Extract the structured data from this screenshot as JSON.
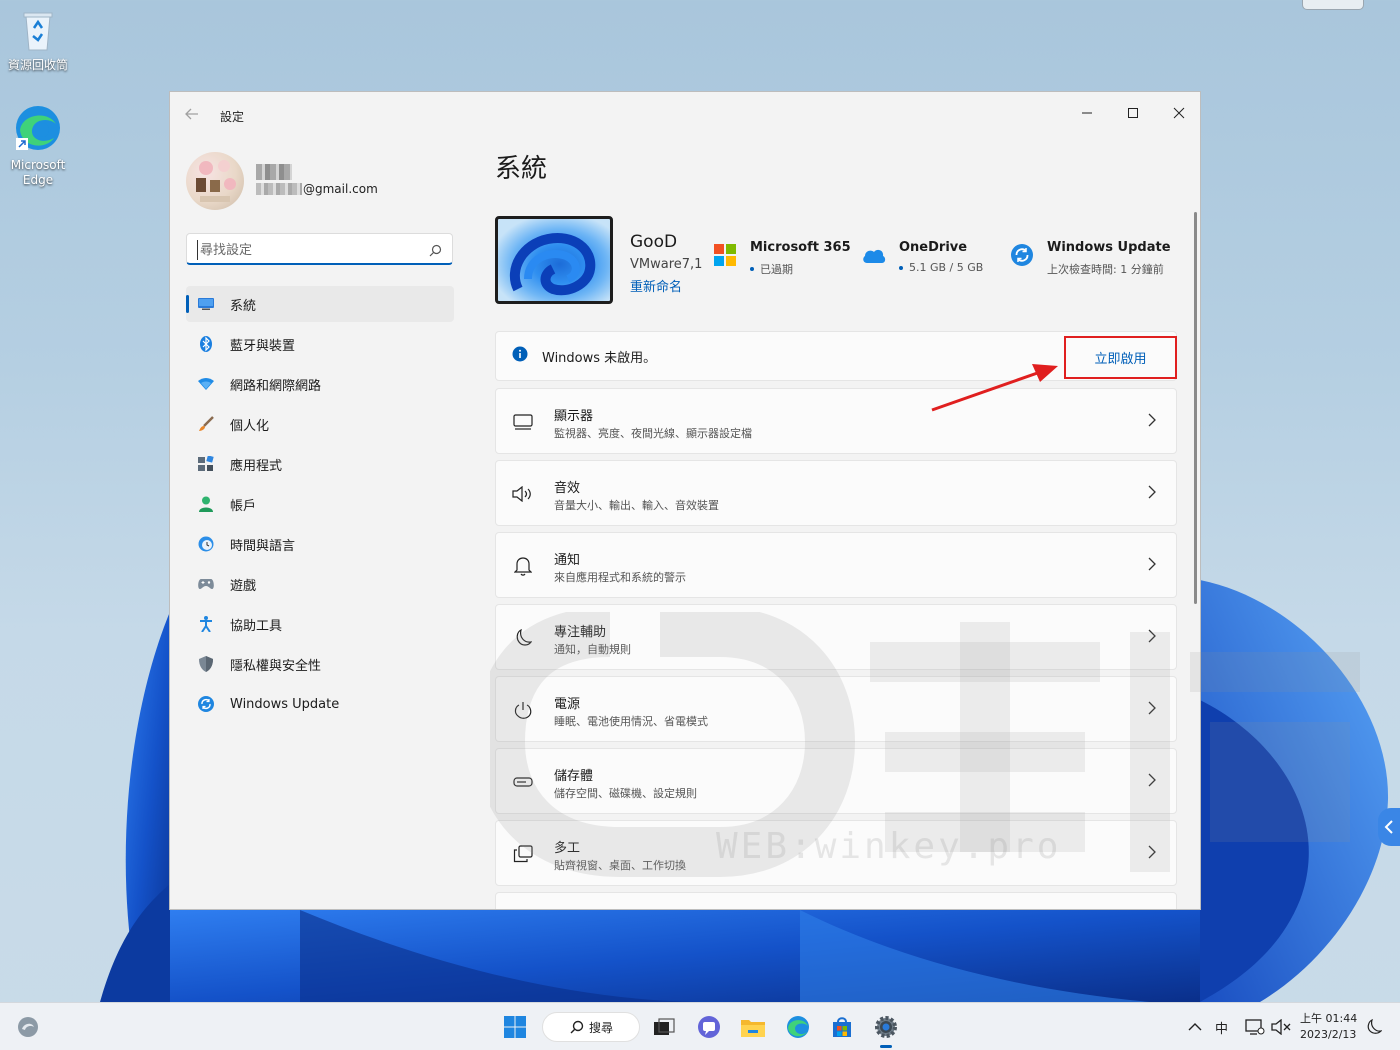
{
  "desktop": {
    "icons": [
      {
        "label": "資源回收筒"
      },
      {
        "label": "Microsoft Edge"
      }
    ]
  },
  "window": {
    "title": "設定",
    "controls": {
      "minimize": "—",
      "maximize": "☐",
      "close": "✕"
    }
  },
  "profile": {
    "email_suffix": "@gmail.com"
  },
  "search": {
    "placeholder": "尋找設定"
  },
  "sidebar": {
    "items": [
      {
        "label": "系統",
        "icon": "system-icon",
        "active": true
      },
      {
        "label": "藍牙與裝置",
        "icon": "bluetooth-icon"
      },
      {
        "label": "網路和網際網路",
        "icon": "wifi-icon"
      },
      {
        "label": "個人化",
        "icon": "brush-icon"
      },
      {
        "label": "應用程式",
        "icon": "apps-icon"
      },
      {
        "label": "帳戶",
        "icon": "account-icon"
      },
      {
        "label": "時間與語言",
        "icon": "globe-clock-icon"
      },
      {
        "label": "遊戲",
        "icon": "gamepad-icon"
      },
      {
        "label": "協助工具",
        "icon": "accessibility-icon"
      },
      {
        "label": "隱私權與安全性",
        "icon": "shield-icon"
      },
      {
        "label": "Windows Update",
        "icon": "update-icon"
      }
    ]
  },
  "main": {
    "page_title": "系統",
    "device": {
      "name": "GooD",
      "model": "VMware7,1",
      "rename_label": "重新命名"
    },
    "info_cards": [
      {
        "title": "Microsoft 365",
        "subtitle": "已過期",
        "icon": "microsoft-logo-icon"
      },
      {
        "title": "OneDrive",
        "subtitle": "5.1 GB / 5 GB",
        "icon": "onedrive-cloud-icon"
      },
      {
        "title": "Windows Update",
        "subtitle": "上次檢查時間: 1 分鐘前",
        "icon": "windows-update-icon"
      }
    ],
    "activation": {
      "text": "Windows 未啟用。",
      "button_label": "立即啟用"
    },
    "settings": [
      {
        "title": "顯示器",
        "subtitle": "監視器、亮度、夜間光線、顯示器設定檔",
        "icon": "display-icon"
      },
      {
        "title": "音效",
        "subtitle": "音量大小、輸出、輸入、音效裝置",
        "icon": "speaker-icon"
      },
      {
        "title": "通知",
        "subtitle": "來自應用程式和系統的警示",
        "icon": "bell-icon"
      },
      {
        "title": "專注輔助",
        "subtitle": "通知，自動規則",
        "icon": "moon-icon"
      },
      {
        "title": "電源",
        "subtitle": "睡眠、電池使用情況、省電模式",
        "icon": "power-icon"
      },
      {
        "title": "儲存體",
        "subtitle": "儲存空間、磁碟機、設定規則",
        "icon": "storage-icon"
      },
      {
        "title": "多工",
        "subtitle": "貼齊視窗、桌面、工作切換",
        "icon": "multitask-icon"
      }
    ]
  },
  "watermark": {
    "url": "WEB:winkey.pro"
  },
  "taskbar": {
    "search_label": "搜尋",
    "ime_label": "中",
    "clock": {
      "time": "上午 01:44",
      "date": "2023/2/13"
    }
  },
  "colors": {
    "accent": "#005fb8",
    "highlight": "#e01f1f",
    "window_bg": "#f3f3f3"
  }
}
